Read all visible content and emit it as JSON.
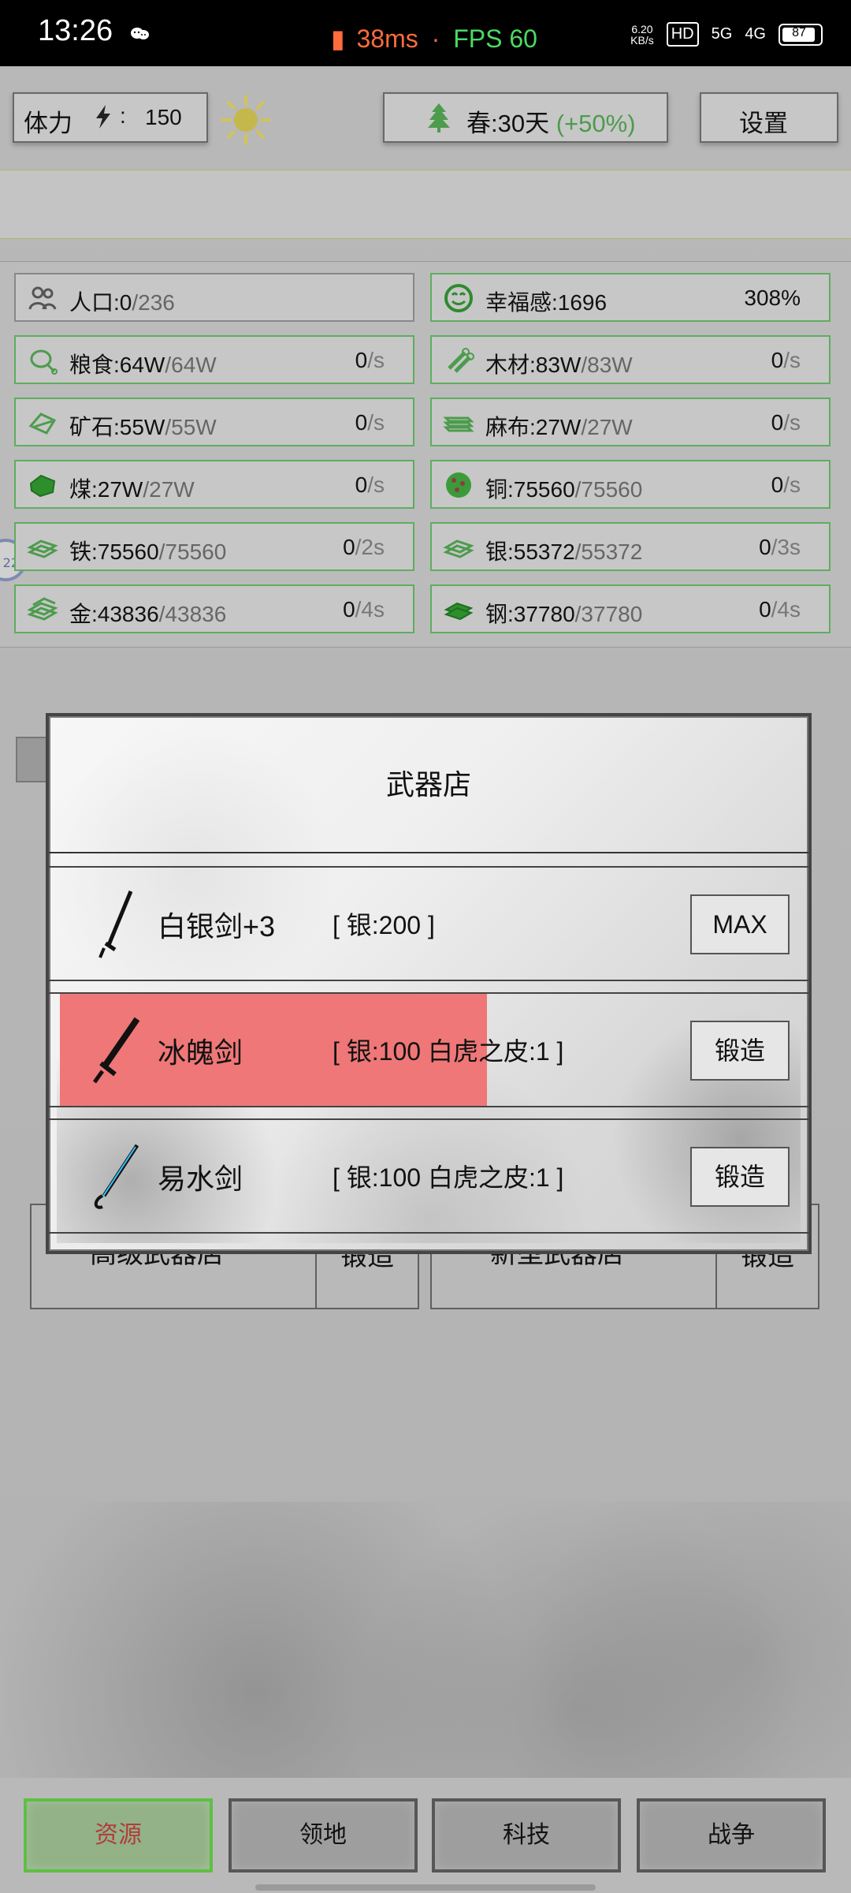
{
  "status_bar": {
    "time": "13:26",
    "latency": "38ms",
    "fps": "FPS 60",
    "network_speed_top": "6.20",
    "network_speed_bottom": "KB/s",
    "hd": "HD",
    "signal_1": "5G",
    "signal_2": "4G",
    "battery": "87"
  },
  "top_bar": {
    "power_label": "体力",
    "power_value": "150",
    "season": "春:30天",
    "season_bonus": "(+50%)",
    "settings": "设置"
  },
  "stats": [
    {
      "label": "人口:0",
      "cap": "/236",
      "rate_value": "",
      "rate_unit": "",
      "icon": "people-icon",
      "color": "#888888"
    },
    {
      "label": "幸福感:1696",
      "cap": "",
      "rate_value": "308%",
      "rate_unit": "",
      "icon": "smile-icon",
      "color": "#5fad5f"
    },
    {
      "label": "粮食:64W",
      "cap": "/64W",
      "rate_value": "0",
      "rate_unit": "/s",
      "icon": "meat-icon",
      "color": "#5fad5f"
    },
    {
      "label": "木材:83W",
      "cap": "/83W",
      "rate_value": "0",
      "rate_unit": "/s",
      "icon": "wood-icon",
      "color": "#5fad5f"
    },
    {
      "label": "矿石:55W",
      "cap": "/55W",
      "rate_value": "0",
      "rate_unit": "/s",
      "icon": "ore-icon",
      "color": "#5fad5f"
    },
    {
      "label": "麻布:27W",
      "cap": "/27W",
      "rate_value": "0",
      "rate_unit": "/s",
      "icon": "cloth-icon",
      "color": "#5fad5f"
    },
    {
      "label": "煤:27W",
      "cap": "/27W",
      "rate_value": "0",
      "rate_unit": "/s",
      "icon": "coal-icon",
      "color": "#5fad5f"
    },
    {
      "label": "铜:75560",
      "cap": "/75560",
      "rate_value": "0",
      "rate_unit": "/s",
      "icon": "copper-icon",
      "color": "#5fad5f"
    },
    {
      "label": "铁:75560",
      "cap": "/75560",
      "rate_value": "0",
      "rate_unit": "/2s",
      "icon": "iron-icon",
      "color": "#5fad5f"
    },
    {
      "label": "银:55372",
      "cap": "/55372",
      "rate_value": "0",
      "rate_unit": "/3s",
      "icon": "silver-icon",
      "color": "#5fad5f"
    },
    {
      "label": "金:43836",
      "cap": "/43836",
      "rate_value": "0",
      "rate_unit": "/4s",
      "icon": "gold-icon",
      "color": "#5fad5f"
    },
    {
      "label": "钢:37780",
      "cap": "/37780",
      "rate_value": "0",
      "rate_unit": "/4s",
      "icon": "steel-icon",
      "color": "#5fad5f"
    }
  ],
  "background_shops": {
    "advanced": "高级武器店",
    "advanced_button": "锻造",
    "newtype": "新型武器店",
    "newtype_button": "锻造"
  },
  "modal": {
    "title": "武器店",
    "items": [
      {
        "name": "白银剑+3",
        "cost": "[ 银:200 ]",
        "button": "MAX",
        "progress": 0
      },
      {
        "name": "冰魄剑",
        "cost": "[ 银:100   白虎之皮:1 ]",
        "button": "锻造",
        "progress": 0.57
      },
      {
        "name": "易水剑",
        "cost": "[ 银:100   白虎之皮:1 ]",
        "button": "锻造",
        "progress": 0
      }
    ]
  },
  "bottom_nav": [
    "资源",
    "领地",
    "科技",
    "战争"
  ],
  "colors": {
    "accent_green": "#5fad5f",
    "active_nav_text": "#b13d3d",
    "progress_red": "#ef7777"
  }
}
